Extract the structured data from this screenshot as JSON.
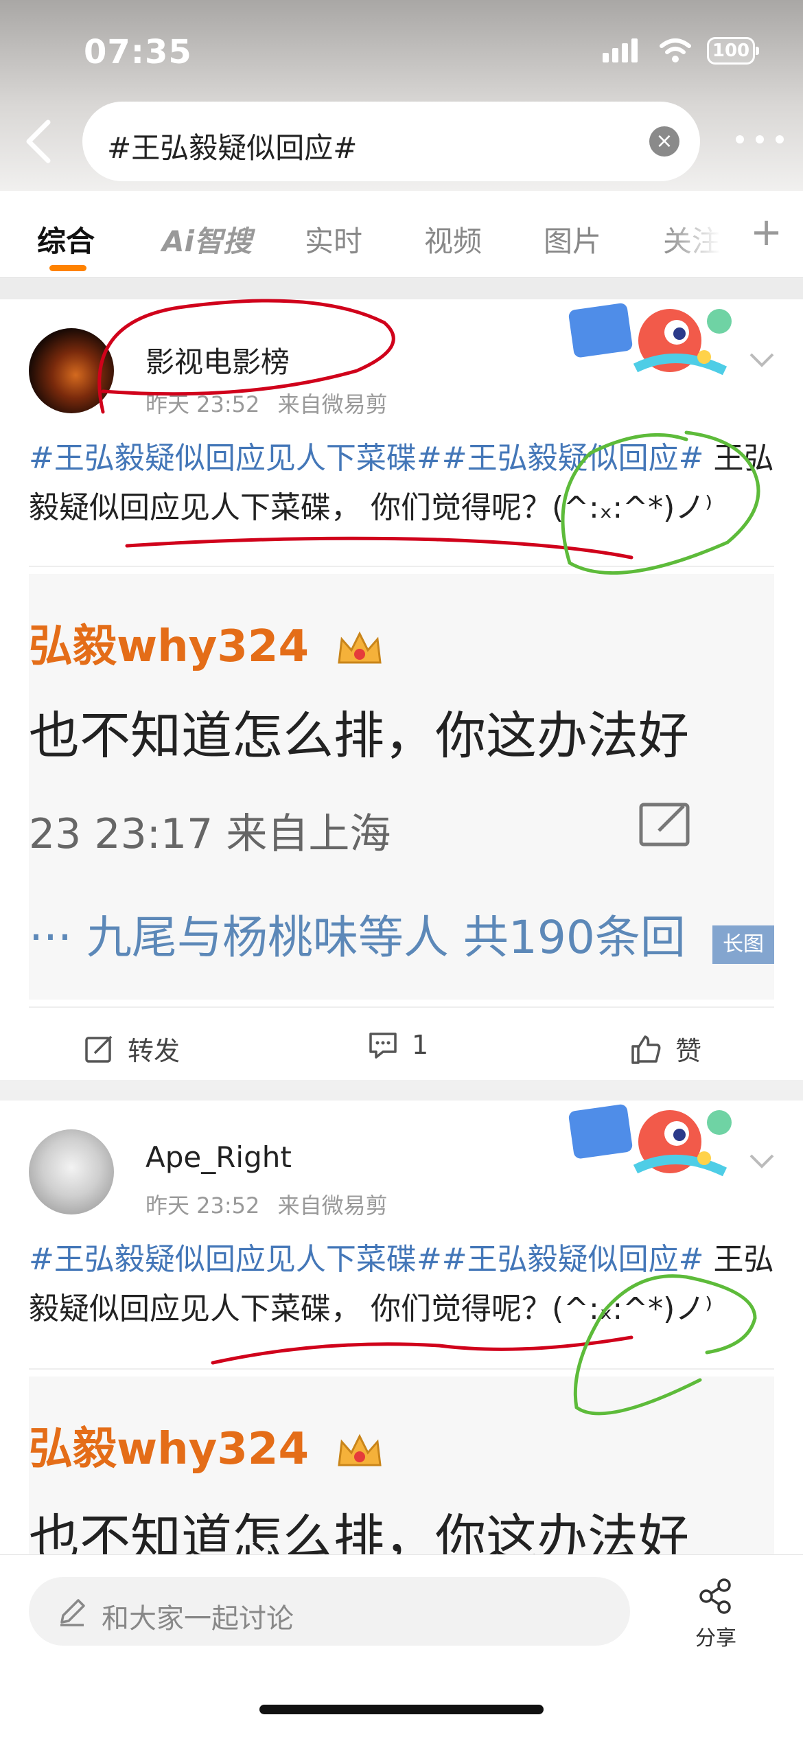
{
  "status_bar": {
    "time": "07:35",
    "battery": "100"
  },
  "search": {
    "query": "#王弘毅疑似回应#"
  },
  "tabs": [
    {
      "label": "综合",
      "active": true
    },
    {
      "label": "Ai智搜",
      "active": false
    },
    {
      "label": "实时",
      "active": false
    },
    {
      "label": "视频",
      "active": false
    },
    {
      "label": "图片",
      "active": false
    },
    {
      "label": "关注",
      "active": false
    }
  ],
  "posts": [
    {
      "username": "影视电影榜",
      "time": "昨天 23:52",
      "source": "来自微易剪",
      "topic1": "#王弘毅疑似回应见人下菜碟#",
      "topic2": "#王弘毅疑似回应#",
      "text": " 王弘毅疑似回应见人下菜碟， 你们觉得呢？(^:ₓ:^*)ノ⁾",
      "image": {
        "name_line": "弘毅why324",
        "body_line": "也不知道怎么排，你这办法好",
        "date_line": "23 23:17  来自上海",
        "reply_line": "···  九尾与杨桃味等人  共190条回",
        "badge": "长图"
      },
      "actions": {
        "repost": "转发",
        "comments": "1",
        "like": "赞"
      }
    },
    {
      "username": "Ape_Right",
      "time": "昨天 23:52",
      "source": "来自微易剪",
      "topic1": "#王弘毅疑似回应见人下菜碟#",
      "topic2": "#王弘毅疑似回应#",
      "text": " 王弘毅疑似回应见人下菜碟， 你们觉得呢？(^:ₓ:^*)ノ⁾",
      "image": {
        "name_line": "弘毅why324",
        "body_line": "也不知道怎么排，你这办法好"
      }
    }
  ],
  "bottom": {
    "comment_placeholder": "和大家一起讨论",
    "share_label": "分享"
  },
  "colors": {
    "accent": "#ff8200",
    "topic_link": "#4477b8",
    "annotation_red": "#d0021b",
    "annotation_green": "#5dbb3a"
  }
}
